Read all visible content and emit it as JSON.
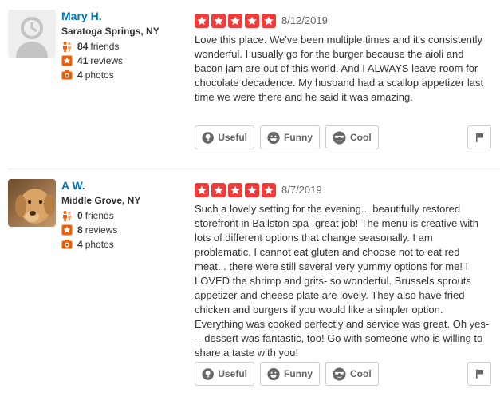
{
  "colors": {
    "link": "#0073bb",
    "star": "#f43939",
    "text": "#333333",
    "muted": "#666666",
    "stat_icon": "#f15c00"
  },
  "reviews": [
    {
      "user": {
        "name": "Mary H.",
        "location": "Saratoga Springs, NY",
        "friends_count": "84",
        "friends_label": "friends",
        "reviews_count": "41",
        "reviews_label": "reviews",
        "photos_count": "4",
        "photos_label": "photos",
        "avatar": "default-user-icon"
      },
      "rating": 5,
      "date": "8/12/2019",
      "text": "Love this place. We've been multiple times and it's consistently wonderful. I usually go for the burger because the aioli and bacon jam are out of this world. And I ALWAYS leave room for chocolate decadence. My husband had a scallop appetizer last time we were there and he said it was amazing.",
      "buttons": {
        "useful": "Useful",
        "funny": "Funny",
        "cool": "Cool"
      }
    },
    {
      "user": {
        "name": "A W.",
        "location": "Middle Grove, NY",
        "friends_count": "0",
        "friends_label": "friends",
        "reviews_count": "8",
        "reviews_label": "reviews",
        "photos_count": "4",
        "photos_label": "photos",
        "avatar": "dog-photo"
      },
      "rating": 5,
      "date": "8/7/2019",
      "text": "Such a lovely setting for the evening...  beautifully restored storefront in Ballston spa- great job! The menu is creative with lots of different options that change seasonally. I am problematic, I cannot eat gluten and choose not to eat red meat... there were still several very yummy options for me! I LOVED the shrimp and grits- so wonderful. Brussels sprouts appetizer and cheese plate are lovely. They also have fried chicken and burgers if you would like a simpler option. Everything was cooked perfectly and service was great. Oh yes--- dessert was fantastic, too! Go with someone who is willing to share a taste with you!",
      "buttons": {
        "useful": "Useful",
        "funny": "Funny",
        "cool": "Cool"
      }
    }
  ]
}
